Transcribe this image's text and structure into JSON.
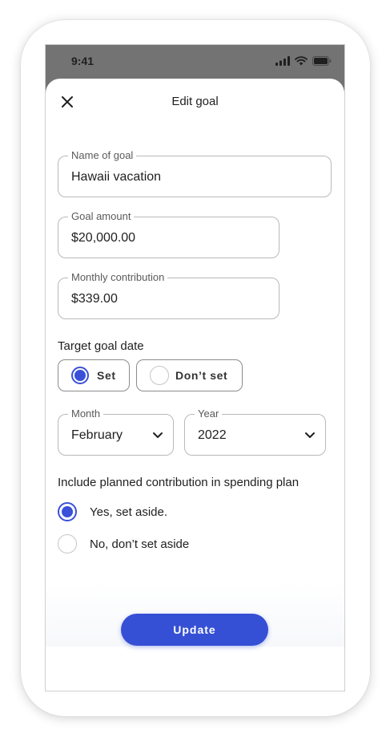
{
  "status_bar": {
    "time": "9:41"
  },
  "header": {
    "title": "Edit goal",
    "close_icon": "close-icon"
  },
  "fields": {
    "name": {
      "label": "Name of goal",
      "value": "Hawaii vacation"
    },
    "amount": {
      "label": "Goal amount",
      "value": "$20,000.00"
    },
    "monthly": {
      "label": "Monthly contribution",
      "value": "$339.00"
    }
  },
  "target_date": {
    "label": "Target goal date",
    "options": [
      {
        "label": "Set",
        "selected": true
      },
      {
        "label": "Don’t set",
        "selected": false
      }
    ],
    "month": {
      "label": "Month",
      "value": "February"
    },
    "year": {
      "label": "Year",
      "value": "2022"
    }
  },
  "spending_plan": {
    "label": "Include planned contribution in spending plan",
    "options": [
      {
        "label": "Yes, set aside.",
        "selected": true
      },
      {
        "label": "No, don’t set aside",
        "selected": false
      }
    ]
  },
  "footer": {
    "update_label": "Update"
  },
  "colors": {
    "accent": "#3550d4",
    "status_bar": "#737373",
    "border": "#b9b9b9"
  }
}
